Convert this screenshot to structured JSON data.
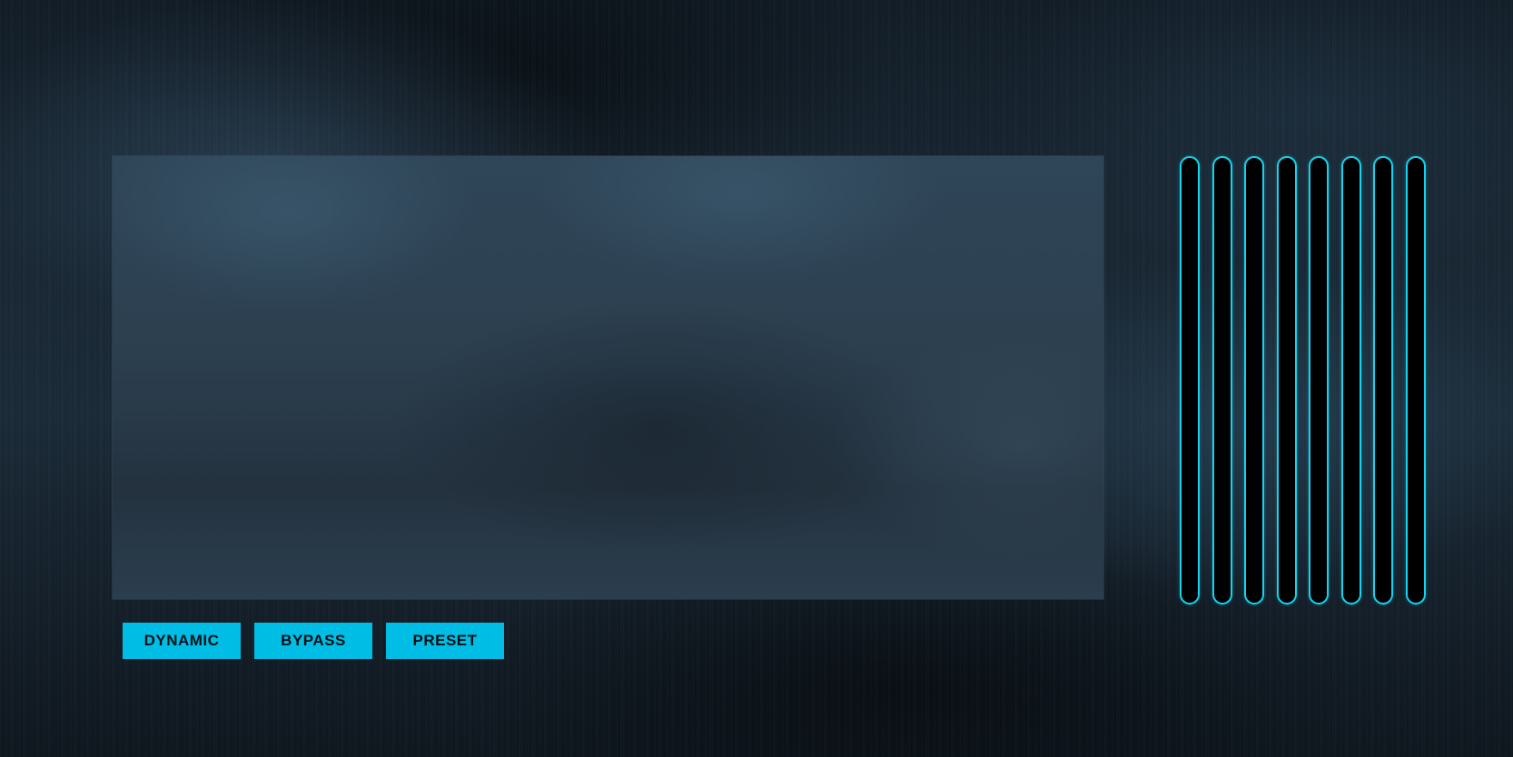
{
  "buttons": {
    "dynamic": "DYNAMIC",
    "bypass": "BYPASS",
    "preset": "PRESET"
  },
  "sliders": {
    "count": 8
  },
  "colors": {
    "accent": "#00bde5",
    "slider_outline": "#16d2ee",
    "slider_fill": "#000000",
    "background": "#182632",
    "panel": "#2c3f4f"
  }
}
